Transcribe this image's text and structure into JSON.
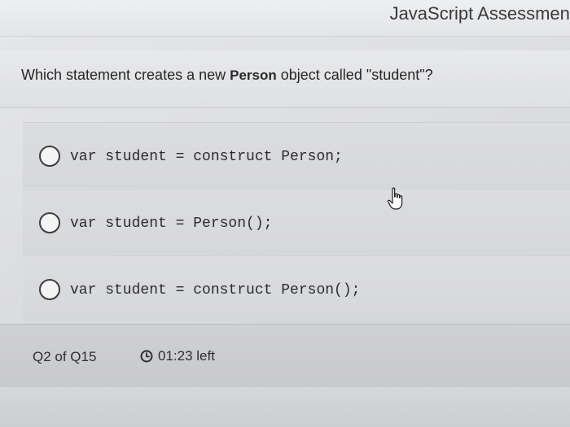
{
  "app": {
    "title": "JavaScript Assessment"
  },
  "question": {
    "prefix": "Which statement creates a new ",
    "code_term": "Person",
    "suffix": " object called \"student\"?"
  },
  "options": [
    {
      "label": "var student = construct Person;",
      "selected": false
    },
    {
      "label": "var student = Person();",
      "selected": false
    },
    {
      "label": "var student = construct Person();",
      "selected": false
    }
  ],
  "footer": {
    "question_counter": "Q2 of Q15",
    "timer_text": "01:23 left",
    "timer_icon": "clock-icon"
  },
  "cursor": {
    "icon": "hand-pointer-icon"
  }
}
